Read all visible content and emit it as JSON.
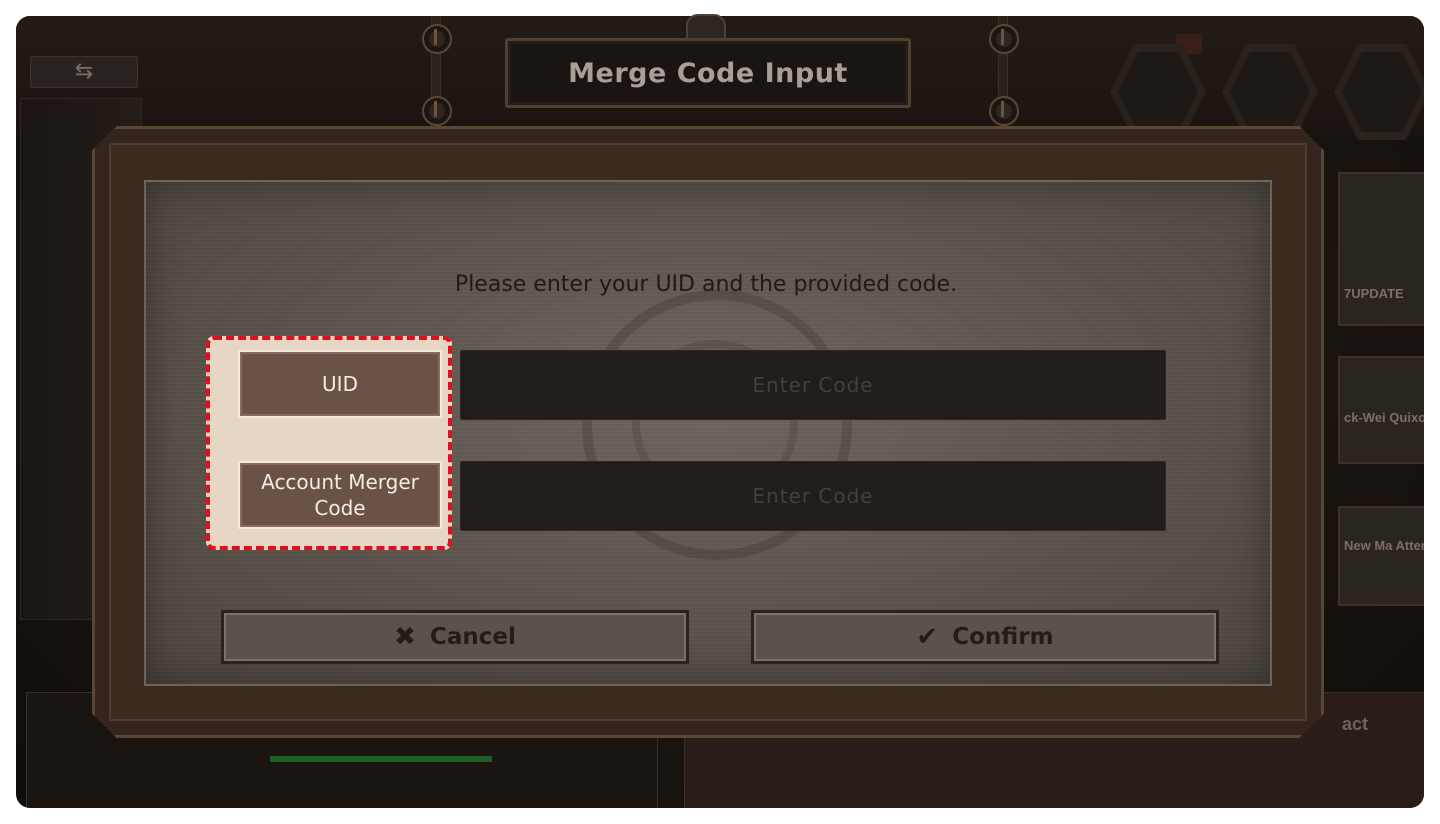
{
  "dialog": {
    "title": "Merge Code Input",
    "instruction": "Please enter your UID and the provided code.",
    "fields": [
      {
        "label": "UID",
        "placeholder": "Enter Code",
        "value": ""
      },
      {
        "label": "Account Merger Code",
        "placeholder": "Enter Code",
        "value": ""
      }
    ],
    "cancel_label": "Cancel",
    "confirm_label": "Confirm",
    "cancel_icon": "close-icon",
    "confirm_icon": "checkmark-icon",
    "highlight_color": "#e00f1d"
  },
  "background": {
    "back_icon": "swap-arrows-icon",
    "banners": [
      {
        "text": "7UPDATE"
      },
      {
        "text": "ck-Wei Quixote"
      },
      {
        "text": "New Ma Attenda Check"
      }
    ],
    "bottom_right_text": "act"
  }
}
